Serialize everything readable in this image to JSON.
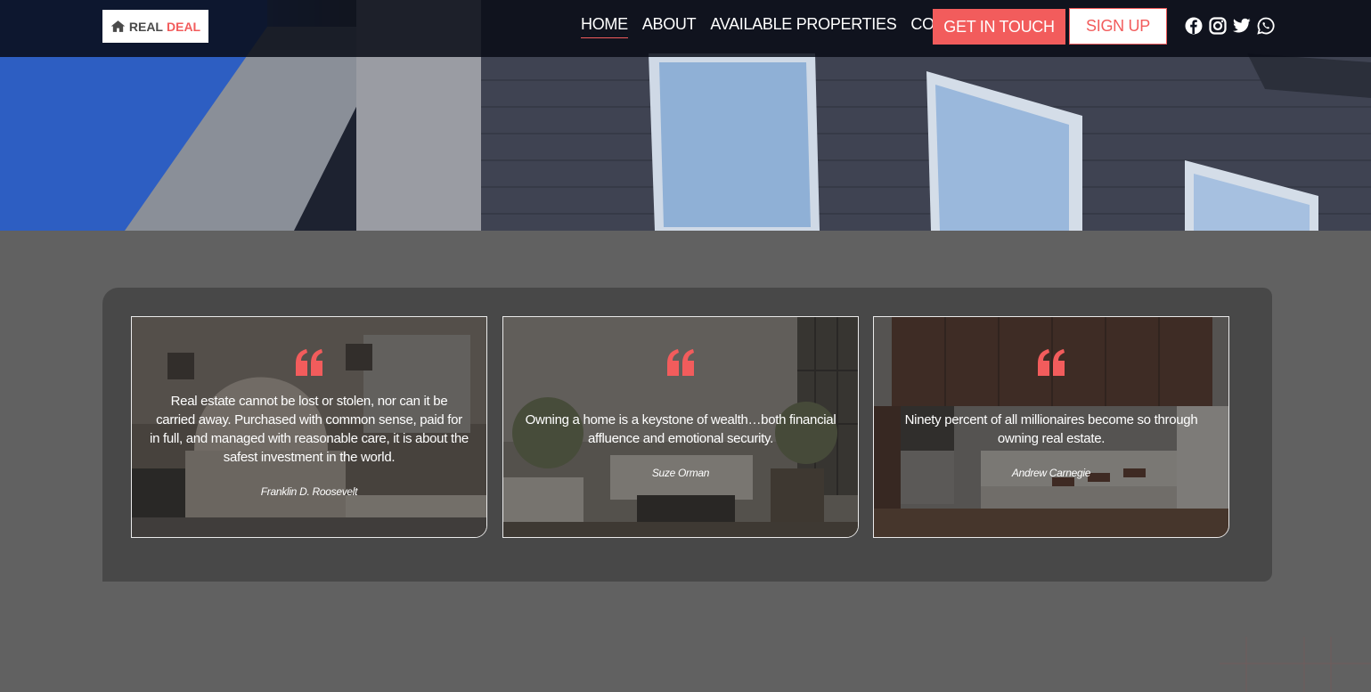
{
  "brand": {
    "word1": "REAL",
    "word2": "DEAL",
    "accent_color": "#f25c5c"
  },
  "nav": {
    "items": [
      {
        "label": "HOME",
        "active": true
      },
      {
        "label": "ABOUT",
        "active": false
      },
      {
        "label": "AVAILABLE PROPERTIES",
        "active": false
      },
      {
        "label": "CONTACT",
        "active": false
      }
    ],
    "cta": "GET IN TOUCH",
    "signup": "SIGN UP"
  },
  "socials": [
    "facebook-icon",
    "instagram-icon",
    "twitter-icon",
    "whatsapp-icon"
  ],
  "quotes": [
    {
      "text": "Real estate cannot be lost or stolen, nor can it be carried away. Purchased with common sense, paid for in full, and managed with reasonable care, it is about the safest investment in the world.",
      "author": "Franklin D. Roosevelt",
      "background": "bedroom-photo"
    },
    {
      "text": "Owning a home is a keystone of wealth…both financial affluence and emotional security.",
      "author": "Suze Orman",
      "background": "living-room-photo"
    },
    {
      "text": "Ninety percent of all millionaires become so through owning real estate.",
      "author": "Andrew Carnegie",
      "background": "kitchen-photo"
    }
  ]
}
